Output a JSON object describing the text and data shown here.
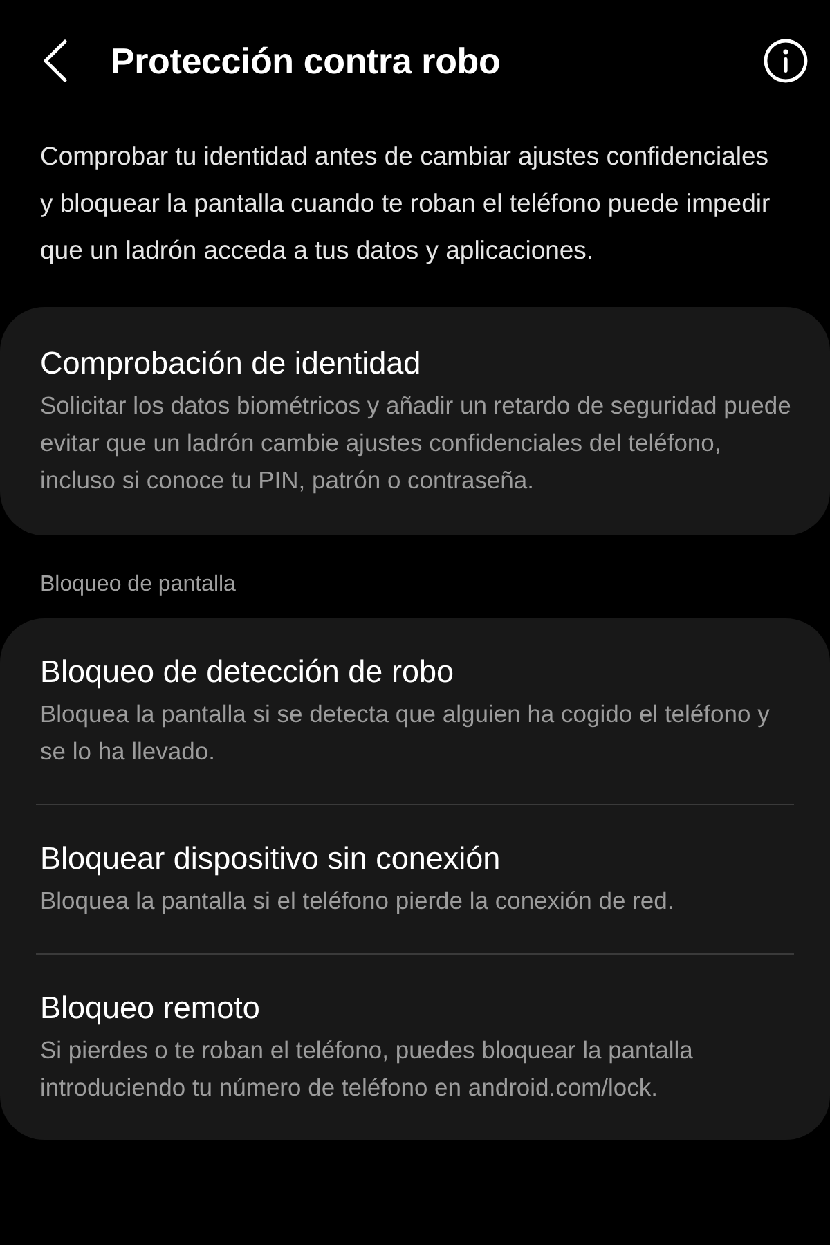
{
  "header": {
    "title": "Protección contra robo"
  },
  "intro": "Comprobar tu identidad antes de cambiar ajustes confidenciales y bloquear la pantalla cuando te roban el teléfono puede impedir que un ladrón acceda a tus datos y aplicaciones.",
  "groups": [
    {
      "items": [
        {
          "title": "Comprobación de identidad",
          "description": "Solicitar los datos biométricos y añadir un retardo de seguridad puede evitar que un ladrón cambie ajustes confidenciales del teléfono, incluso si conoce tu PIN, patrón o contraseña."
        }
      ]
    },
    {
      "header": "Bloqueo de pantalla",
      "items": [
        {
          "title": "Bloqueo de detección de robo",
          "description": "Bloquea la pantalla si se detecta que alguien ha cogido el teléfono y se lo ha llevado."
        },
        {
          "title": "Bloquear dispositivo sin conexión",
          "description": "Bloquea la pantalla si el teléfono pierde la conexión de red."
        },
        {
          "title": "Bloqueo remoto",
          "description": "Si pierdes o te roban el teléfono, puedes bloquear la pantalla introduciendo tu número de teléfono en android.com/lock."
        }
      ]
    }
  ]
}
